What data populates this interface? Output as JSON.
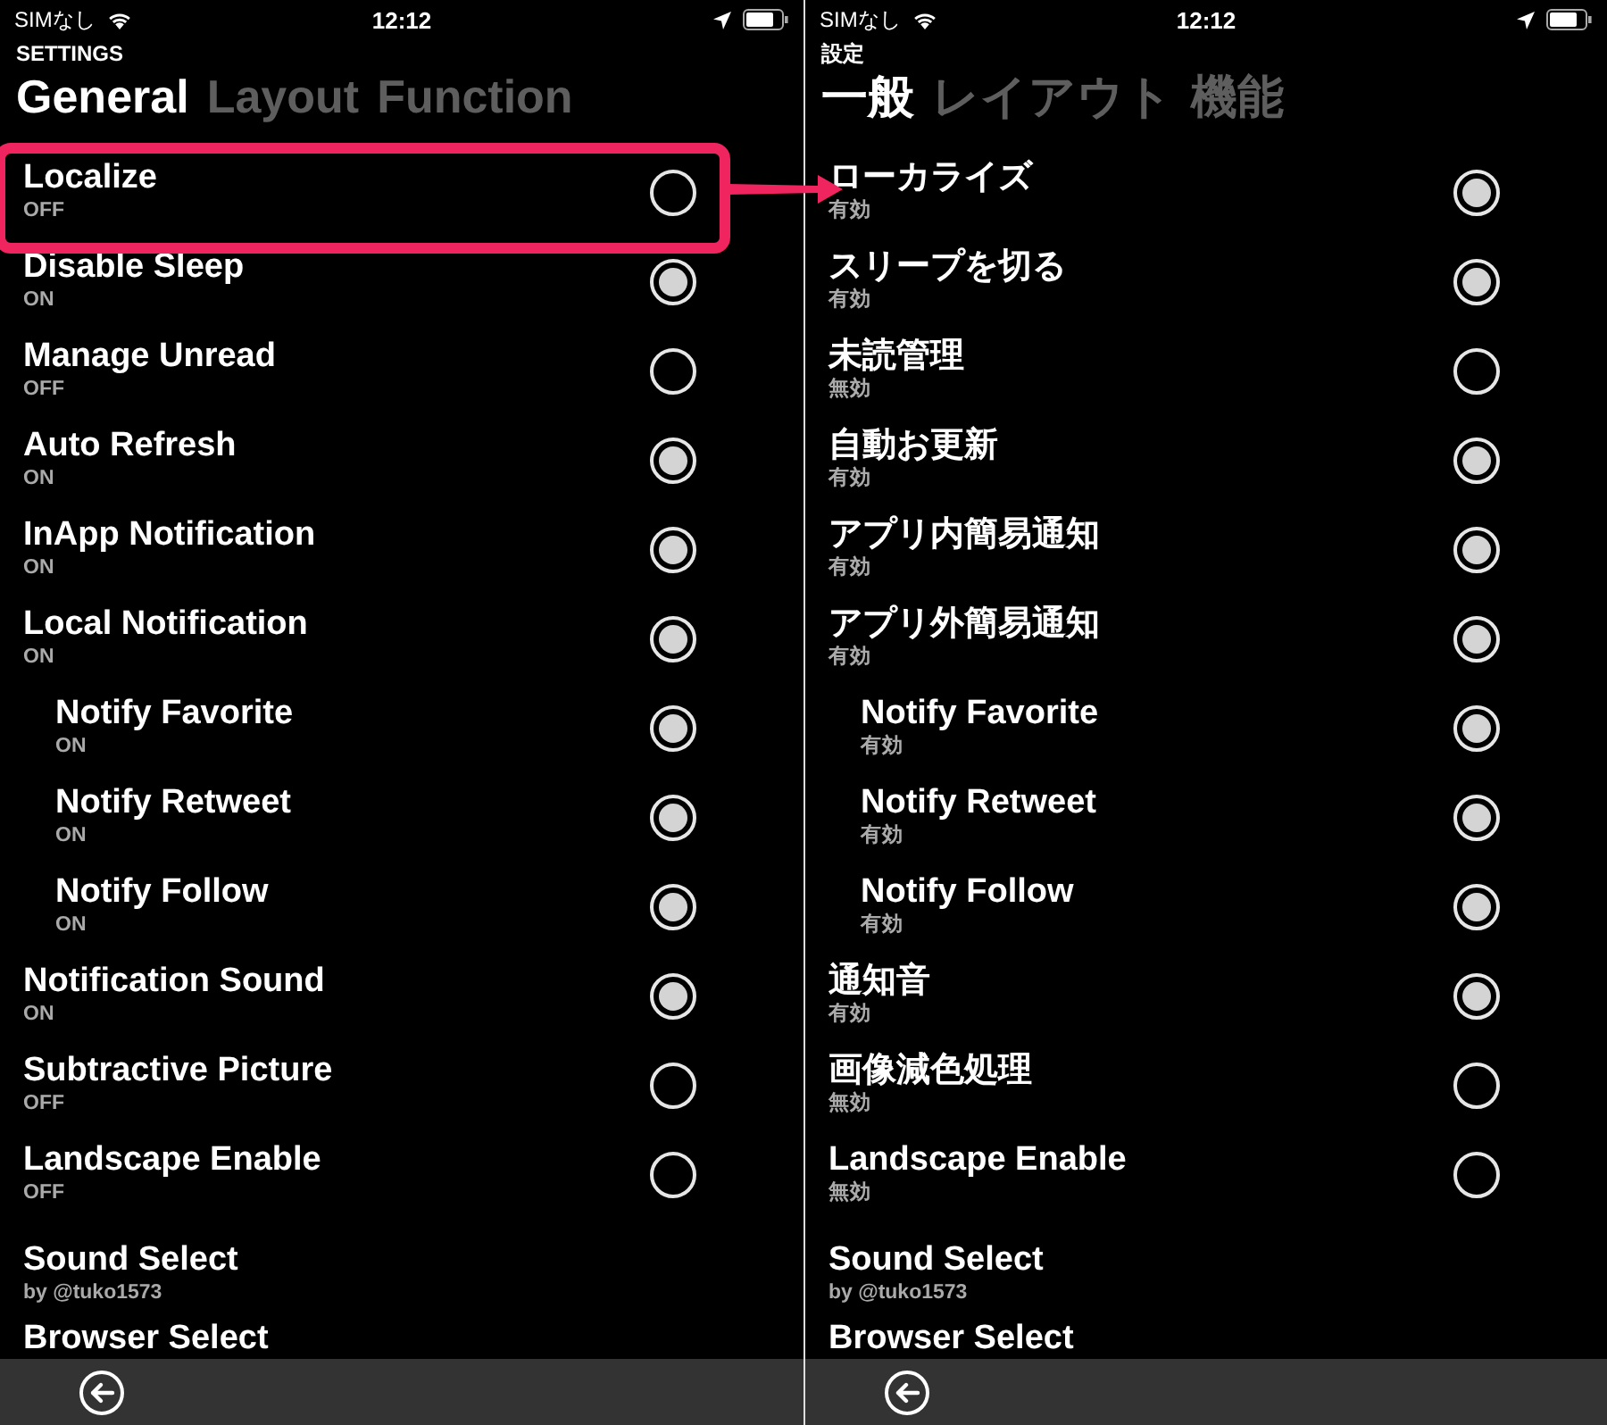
{
  "panels": [
    {
      "status_bar": {
        "carrier": "SIMなし",
        "time": "12:12"
      },
      "header": "SETTINGS",
      "tabs": [
        {
          "label": "General",
          "selected": true
        },
        {
          "label": "Layout",
          "selected": false
        },
        {
          "label": "Function",
          "selected": false
        }
      ],
      "rows": [
        {
          "kind": "toggle",
          "title": "Localize",
          "status": "OFF",
          "on": false,
          "highlighted": true
        },
        {
          "kind": "toggle",
          "title": "Disable Sleep",
          "status": "ON",
          "on": true
        },
        {
          "kind": "toggle",
          "title": "Manage Unread",
          "status": "OFF",
          "on": false
        },
        {
          "kind": "toggle",
          "title": "Auto Refresh",
          "status": "ON",
          "on": true
        },
        {
          "kind": "toggle",
          "title": "InApp Notification",
          "status": "ON",
          "on": true
        },
        {
          "kind": "toggle",
          "title": "Local Notification",
          "status": "ON",
          "on": true,
          "children": [
            {
              "kind": "toggle",
              "title": "Notify Favorite",
              "status": "ON",
              "on": true
            },
            {
              "kind": "toggle",
              "title": "Notify Retweet",
              "status": "ON",
              "on": true
            },
            {
              "kind": "toggle",
              "title": "Notify Follow",
              "status": "ON",
              "on": true
            }
          ]
        },
        {
          "kind": "toggle",
          "title": "Notification Sound",
          "status": "ON",
          "on": true
        },
        {
          "kind": "toggle",
          "title": "Subtractive Picture",
          "status": "OFF",
          "on": false
        },
        {
          "kind": "toggle",
          "title": "Landscape Enable",
          "status": "OFF",
          "on": false
        },
        {
          "kind": "select",
          "title": "Sound Select",
          "status": "by @tuko1573"
        },
        {
          "kind": "select",
          "title": "Browser Select"
        }
      ]
    },
    {
      "status_bar": {
        "carrier": "SIMなし",
        "time": "12:12"
      },
      "header": "設定",
      "tabs": [
        {
          "label": "一般",
          "selected": true
        },
        {
          "label": "レイアウト",
          "selected": false
        },
        {
          "label": "機能",
          "selected": false
        }
      ],
      "rows": [
        {
          "kind": "toggle",
          "title": "ローカライズ",
          "status": "有効",
          "on": true
        },
        {
          "kind": "toggle",
          "title": "スリープを切る",
          "status": "有効",
          "on": true
        },
        {
          "kind": "toggle",
          "title": "未読管理",
          "status": "無効",
          "on": false
        },
        {
          "kind": "toggle",
          "title": "自動お更新",
          "status": "有効",
          "on": true
        },
        {
          "kind": "toggle",
          "title": "アプリ内簡易通知",
          "status": "有効",
          "on": true
        },
        {
          "kind": "toggle",
          "title": "アプリ外簡易通知",
          "status": "有効",
          "on": true,
          "children": [
            {
              "kind": "toggle",
              "title": "Notify Favorite",
              "status": "有効",
              "on": true
            },
            {
              "kind": "toggle",
              "title": "Notify Retweet",
              "status": "有効",
              "on": true
            },
            {
              "kind": "toggle",
              "title": "Notify Follow",
              "status": "有効",
              "on": true
            }
          ]
        },
        {
          "kind": "toggle",
          "title": "通知音",
          "status": "有効",
          "on": true
        },
        {
          "kind": "toggle",
          "title": "画像減色処理",
          "status": "無効",
          "on": false
        },
        {
          "kind": "toggle",
          "title": "Landscape Enable",
          "status": "無効",
          "on": false
        },
        {
          "kind": "select",
          "title": "Sound Select",
          "status": "by @tuko1573"
        },
        {
          "kind": "select",
          "title": "Browser Select"
        }
      ]
    }
  ]
}
